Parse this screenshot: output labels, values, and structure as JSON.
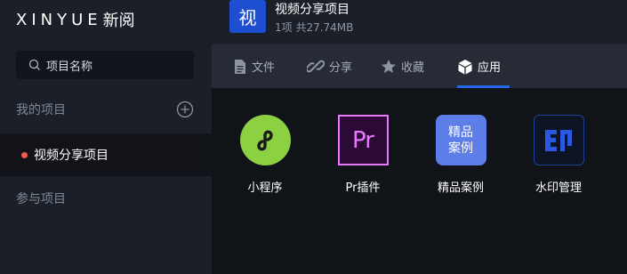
{
  "brand": {
    "name": "XINYUE",
    "name_cn": "新阅"
  },
  "search": {
    "placeholder": "项目名称"
  },
  "sidebar": {
    "my_projects_label": "我的项目",
    "projects": [
      {
        "label": "视频分享项目",
        "status_color": "#f15a4f"
      }
    ],
    "joined_projects_label": "参与项目"
  },
  "project": {
    "avatar_char": "视",
    "title": "视频分享项目",
    "meta": "1项 共27.74MB"
  },
  "tabs": [
    {
      "label": "文件",
      "icon": "file-icon"
    },
    {
      "label": "分享",
      "icon": "link-icon"
    },
    {
      "label": "收藏",
      "icon": "star-icon"
    },
    {
      "label": "应用",
      "icon": "cube-icon",
      "active": true
    }
  ],
  "apps": [
    {
      "label": "小程序",
      "icon": "mini-program-icon",
      "color": "#8cd142"
    },
    {
      "label": "Pr插件",
      "icon": "premiere-icon",
      "color": "#e978ff"
    },
    {
      "label": "精品案例",
      "icon": "showcase-icon",
      "color": "#5d7ee8",
      "icon_text_1": "精品",
      "icon_text_2": "案例"
    },
    {
      "label": "水印管理",
      "icon": "watermark-icon",
      "color": "#2a58e0",
      "icon_text": "EJ"
    }
  ],
  "colors": {
    "accent": "#2467e8",
    "sidebar_bg": "#1b1f27",
    "tab_bar_bg": "#262b35",
    "content_bg": "#101318"
  }
}
